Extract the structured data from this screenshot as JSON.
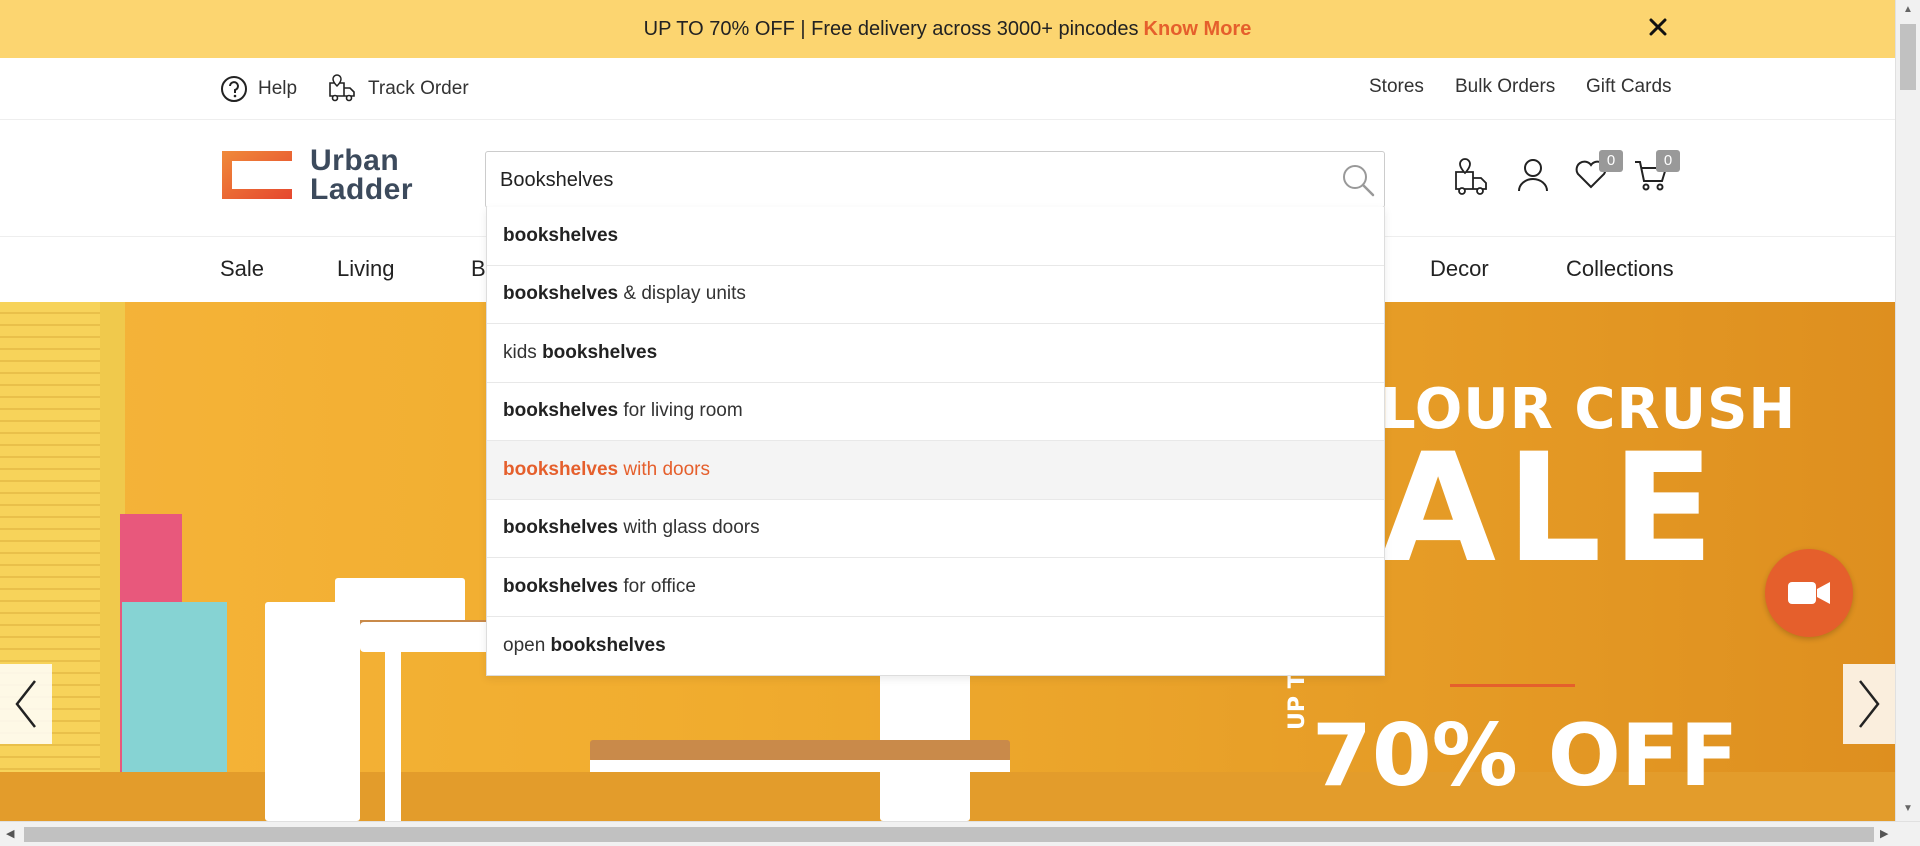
{
  "promo": {
    "text": "UP TO 70% OFF | Free delivery across 3000+ pincodes",
    "link": "Know More",
    "close": "✕"
  },
  "utility": {
    "help": "Help",
    "track_order": "Track Order",
    "stores": "Stores",
    "bulk_orders": "Bulk Orders",
    "gift_cards": "Gift Cards"
  },
  "logo": {
    "line1": "Urban",
    "line2": "Ladder"
  },
  "search": {
    "value": "Bookshelves"
  },
  "header_icons": {
    "wishlist_count": "0",
    "cart_count": "0"
  },
  "nav": {
    "items": [
      "Sale",
      "Living",
      "B",
      "Decor",
      "Collections"
    ]
  },
  "suggestions": [
    {
      "bold": "bookshelves",
      "rest": "",
      "prefix": ""
    },
    {
      "bold": "bookshelves",
      "rest": " & display units",
      "prefix": ""
    },
    {
      "prefix": "kids ",
      "bold": "bookshelves",
      "rest": ""
    },
    {
      "bold": "bookshelves",
      "rest": " for living room",
      "prefix": ""
    },
    {
      "bold": "bookshelves",
      "rest": " with doors",
      "prefix": "",
      "active": true
    },
    {
      "bold": "bookshelves",
      "rest": " with glass doors",
      "prefix": ""
    },
    {
      "bold": "bookshelves",
      "rest": " for office",
      "prefix": ""
    },
    {
      "prefix": "open ",
      "bold": "bookshelves",
      "rest": ""
    }
  ],
  "hero": {
    "line1": "LOUR CRUSH",
    "line2": "ALE",
    "upto": "UP TO",
    "line3": "70% OFF"
  },
  "colors": {
    "promo_bg": "#fcd570",
    "accent": "#e55f2c",
    "logo_text": "#3c4a5c"
  }
}
